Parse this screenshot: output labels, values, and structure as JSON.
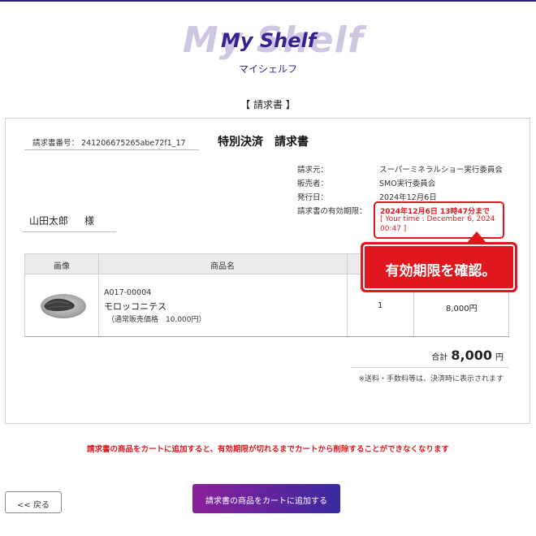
{
  "brand": {
    "logo_text": "My Shelf",
    "logo_subtitle": "マイシェルフ"
  },
  "page_title": "【 請求書 】",
  "invoice": {
    "number_label": "請求書番号：",
    "number": "241206675265abe72f1_17",
    "title": "特別決済　請求書",
    "info": [
      {
        "key": "請求元：",
        "value": "スーパーミネラルショー実行委員会"
      },
      {
        "key": "販売者：",
        "value": "SMO実行委員会"
      },
      {
        "key": "発行日：",
        "value": "2024年12月6日"
      },
      {
        "key": "請求書の有効期限：",
        "value": ""
      }
    ],
    "expiry": {
      "deadline": "2024年12月6日 13時47分まで",
      "your_time_line1": "[ Your time : December 6, 2024",
      "your_time_line2": "00:47 ]"
    },
    "customer_name": "山田太郎",
    "honorific": "様"
  },
  "table": {
    "headers": [
      "画像",
      "商品名",
      "",
      ""
    ],
    "rows": [
      {
        "code": "A017-00004",
        "name": "モロッコニテス",
        "regular_price": "（通常販売価格　10,000円）",
        "quantity": "1",
        "price": "8,000円"
      }
    ]
  },
  "callout": {
    "text": "有効期限を確認。"
  },
  "totals": {
    "label": "合計",
    "amount": "8,000",
    "currency": "円",
    "fee_note": "※送料・手数料等は、決済時に表示されます"
  },
  "warning": "請求書の商品をカートに追加すると、有効期限が切れるまでカートから削除することができなくなります",
  "buttons": {
    "back": "<< 戻る",
    "add_to_cart": "請求書の商品をカートに追加する"
  },
  "colors": {
    "accent_red": "#e0171c",
    "brand_purple": "#3a1f8f",
    "button_gradient_start": "#8b1f9a",
    "button_gradient_end": "#3a2a9f"
  }
}
